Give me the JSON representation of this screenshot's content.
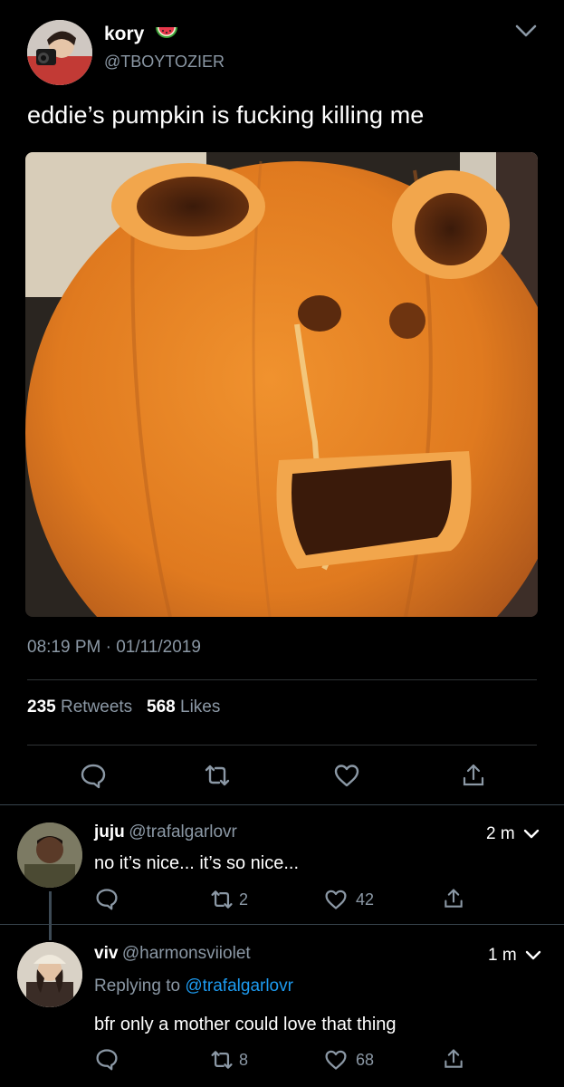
{
  "tweet": {
    "author_name": "kory",
    "author_handle": "@TBOYTOZIER",
    "text": "eddie’s pumpkin is fucking killing me",
    "timestamp": "08:19 PM · 01/11/2019",
    "retweets": "235",
    "retweets_label": "Retweets",
    "likes": "568",
    "likes_label": "Likes"
  },
  "replies": [
    {
      "name": "juju",
      "handle": "@trafalgarlovr",
      "time": "2 m",
      "text": "no it’s nice... it’s so nice...",
      "retweets": "2",
      "likes": "42"
    },
    {
      "name": "viv",
      "handle": "@harmonsviiolet",
      "time": "1 m",
      "replying_prefix": "Replying to ",
      "replying_to": "@trafalgarlovr",
      "text": "bfr only a mother could love that thing",
      "retweets": "8",
      "likes": "68"
    }
  ],
  "colors": {
    "background": "#000000",
    "muted_text": "#8b98a5",
    "link": "#1d9bf0",
    "pumpkin": "#e07a1f"
  }
}
